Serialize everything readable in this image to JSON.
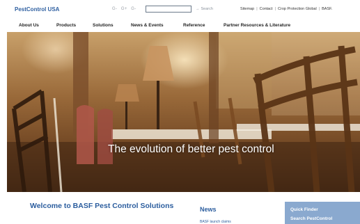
{
  "header": {
    "brand": "PestControl USA",
    "font_size_controls": [
      "G-",
      "G+",
      "G-"
    ],
    "search": {
      "placeholder": "",
      "button_label": "Search"
    },
    "utility_links": [
      "Sitemap",
      "Contact",
      "Crop Protection Global",
      "BASF."
    ]
  },
  "nav": {
    "items": [
      "About Us",
      "Products",
      "Solutions",
      "News & Events",
      "Reference",
      "Partner Resources & Literature"
    ]
  },
  "hero": {
    "tagline": "The evolution of better pest control"
  },
  "main": {
    "welcome_title": "Welcome to BASF Pest Control Solutions"
  },
  "news": {
    "title": "News",
    "first_item": "BASF launch claims"
  },
  "quick_finder": {
    "title": "Quick Finder",
    "link": "Search PestControl"
  },
  "colors": {
    "brand_blue": "#2b5d9e",
    "quick_finder_bg": "#8aa9cf",
    "hero_text": "#ffffff"
  }
}
